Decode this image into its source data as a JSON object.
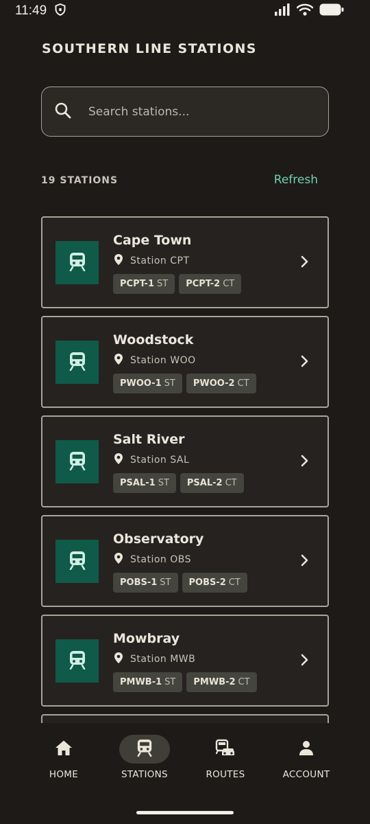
{
  "status_bar": {
    "time": "11:49"
  },
  "header": {
    "title": "SOUTHERN LINE STATIONS"
  },
  "search": {
    "placeholder": "Search stations..."
  },
  "list_header": {
    "count": "19 STATIONS",
    "refresh": "Refresh"
  },
  "stations": [
    {
      "name": "Cape Town",
      "code": "Station CPT",
      "platforms": [
        {
          "code": "PCPT-1",
          "type": "ST"
        },
        {
          "code": "PCPT-2",
          "type": "CT"
        }
      ]
    },
    {
      "name": "Woodstock",
      "code": "Station WOO",
      "platforms": [
        {
          "code": "PWOO-1",
          "type": "ST"
        },
        {
          "code": "PWOO-2",
          "type": "CT"
        }
      ]
    },
    {
      "name": "Salt River",
      "code": "Station SAL",
      "platforms": [
        {
          "code": "PSAL-1",
          "type": "ST"
        },
        {
          "code": "PSAL-2",
          "type": "CT"
        }
      ]
    },
    {
      "name": "Observatory",
      "code": "Station OBS",
      "platforms": [
        {
          "code": "POBS-1",
          "type": "ST"
        },
        {
          "code": "POBS-2",
          "type": "CT"
        }
      ]
    },
    {
      "name": "Mowbray",
      "code": "Station MWB",
      "platforms": [
        {
          "code": "PMWB-1",
          "type": "ST"
        },
        {
          "code": "PMWB-2",
          "type": "CT"
        }
      ]
    }
  ],
  "nav": {
    "items": [
      {
        "label": "HOME",
        "icon": "home-icon",
        "active": false
      },
      {
        "label": "STATIONS",
        "icon": "train-icon",
        "active": true
      },
      {
        "label": "ROUTES",
        "icon": "routes-icon",
        "active": false
      },
      {
        "label": "ACCOUNT",
        "icon": "account-icon",
        "active": false
      }
    ]
  },
  "colors": {
    "accent": "#6fd0b0",
    "tile": "#0f5a48",
    "background": "#1e1a17"
  }
}
